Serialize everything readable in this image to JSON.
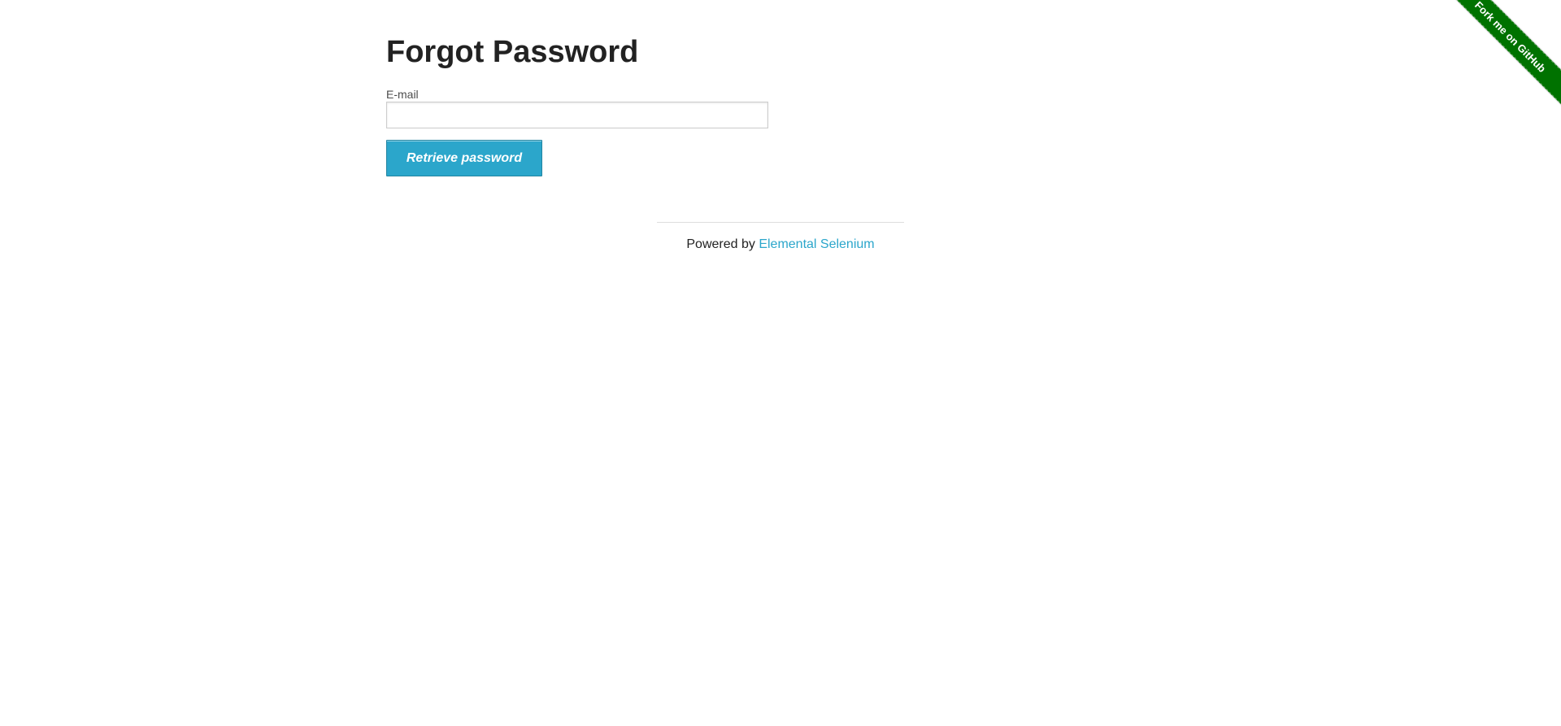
{
  "page": {
    "title": "Forgot Password"
  },
  "form": {
    "email_label": "E-mail",
    "email_value": "",
    "email_placeholder": "",
    "submit_label": "Retrieve password"
  },
  "footer": {
    "prefix": "Powered by ",
    "link_text": "Elemental Selenium"
  },
  "ribbon": {
    "text": "Fork me on GitHub"
  },
  "colors": {
    "button_bg": "#2ba6cb",
    "link": "#2ba6cb",
    "ribbon_bg": "#007200",
    "heading": "#222222"
  }
}
